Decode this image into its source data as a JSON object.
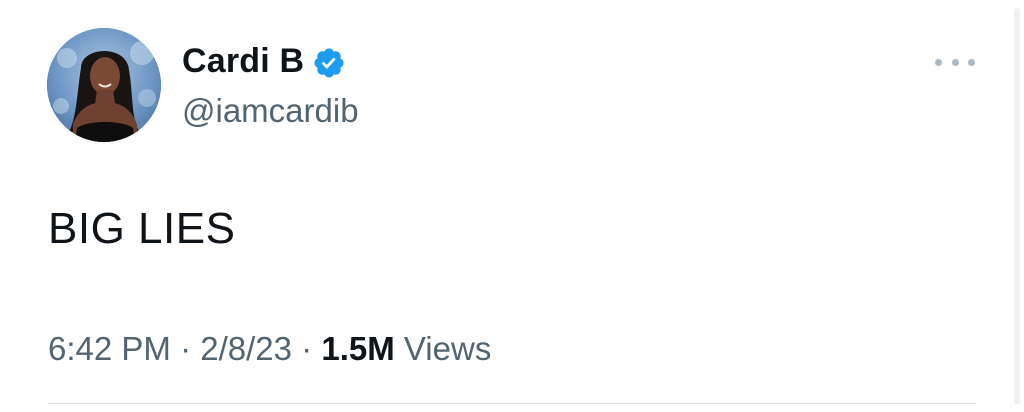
{
  "tweet": {
    "author": {
      "display_name": "Cardi B",
      "handle": "@iamcardib",
      "verified": true,
      "avatar_icon": "profile-photo"
    },
    "text": "BIG LIES",
    "meta": {
      "time": "6:42 PM",
      "separator": "·",
      "date": "2/8/23",
      "views_count": "1.5M",
      "views_label": "Views"
    },
    "more_icon": "ellipsis-icon"
  },
  "colors": {
    "verified_blue": "#1d9bf0",
    "secondary_text": "#536471",
    "primary_text": "#0f1419"
  }
}
